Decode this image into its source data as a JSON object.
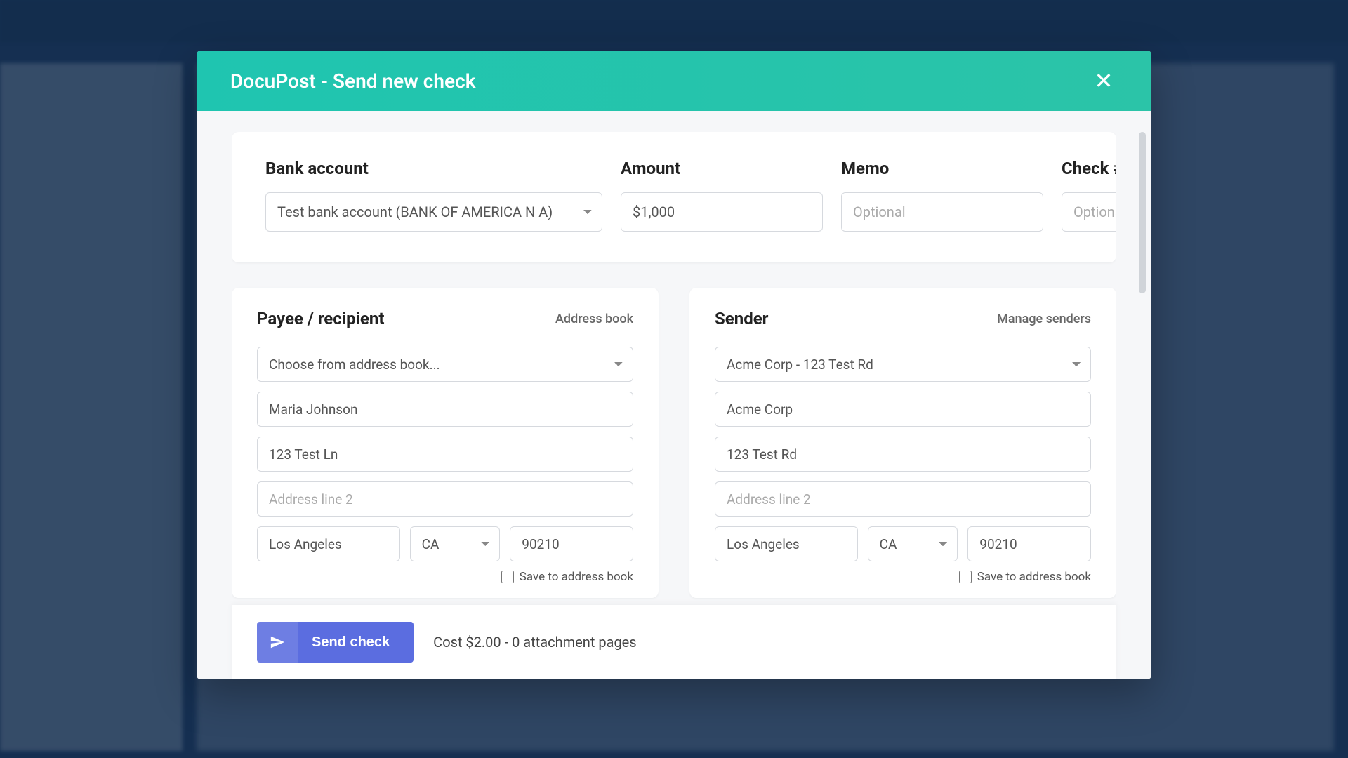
{
  "modal": {
    "title": "DocuPost - Send new check"
  },
  "top": {
    "bank_label": "Bank account",
    "bank_value": "Test bank account (BANK OF AMERICA N A)",
    "amount_label": "Amount",
    "amount_value": "$1,000",
    "memo_label": "Memo",
    "memo_placeholder": "Optional",
    "check_label": "Check #",
    "check_placeholder": "Optional"
  },
  "payee": {
    "title": "Payee / recipient",
    "link": "Address book",
    "select_placeholder": "Choose from address book...",
    "name": "Maria Johnson",
    "addr1": "123 Test Ln",
    "addr2_placeholder": "Address line 2",
    "city": "Los Angeles",
    "state": "CA",
    "zip": "90210",
    "save_label": "Save to address book"
  },
  "sender": {
    "title": "Sender",
    "link": "Manage senders",
    "select_value": "Acme Corp - 123 Test Rd",
    "name": "Acme Corp",
    "addr1": "123 Test Rd",
    "addr2_placeholder": "Address line 2",
    "city": "Los Angeles",
    "state": "CA",
    "zip": "90210",
    "save_label": "Save to address book"
  },
  "footer": {
    "send_label": "Send check",
    "cost_text": "Cost $2.00 - 0 attachment pages"
  }
}
